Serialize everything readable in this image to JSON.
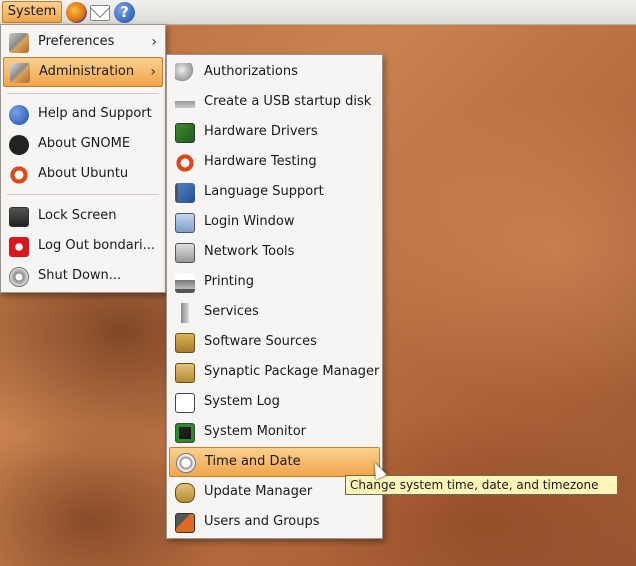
{
  "panel": {
    "menu_label": "System",
    "launchers": [
      "firefox-icon",
      "mail-icon",
      "help-icon"
    ],
    "help_glyph": "?"
  },
  "system_menu": {
    "items": [
      {
        "label": "Preferences",
        "icon": "preferences-icon",
        "submenu": true
      },
      {
        "label": "Administration",
        "icon": "administration-icon",
        "submenu": true,
        "highlighted": true
      },
      {
        "label": "Help and Support",
        "icon": "help-icon"
      },
      {
        "label": "About GNOME",
        "icon": "gnome-foot-icon"
      },
      {
        "label": "About Ubuntu",
        "icon": "ubuntu-icon"
      },
      {
        "label": "Lock Screen",
        "icon": "lock-screen-icon"
      },
      {
        "label": "Log Out bondari...",
        "icon": "log-out-icon"
      },
      {
        "label": "Shut Down...",
        "icon": "shut-down-icon"
      }
    ],
    "arrow_glyph": "›"
  },
  "admin_menu": {
    "items": [
      {
        "label": "Authorizations",
        "icon": "keys-icon"
      },
      {
        "label": "Create a USB startup disk",
        "icon": "usb-disk-icon"
      },
      {
        "label": "Hardware Drivers",
        "icon": "hardware-drivers-icon"
      },
      {
        "label": "Hardware Testing",
        "icon": "hardware-testing-icon"
      },
      {
        "label": "Language Support",
        "icon": "language-flag-icon"
      },
      {
        "label": "Login Window",
        "icon": "login-window-icon"
      },
      {
        "label": "Network Tools",
        "icon": "network-tools-icon"
      },
      {
        "label": "Printing",
        "icon": "printer-icon"
      },
      {
        "label": "Services",
        "icon": "services-icon"
      },
      {
        "label": "Software Sources",
        "icon": "software-sources-icon"
      },
      {
        "label": "Synaptic Package Manager",
        "icon": "synaptic-icon"
      },
      {
        "label": "System Log",
        "icon": "system-log-icon"
      },
      {
        "label": "System Monitor",
        "icon": "system-monitor-icon"
      },
      {
        "label": "Time and Date",
        "icon": "time-date-icon",
        "highlighted": true
      },
      {
        "label": "Update Manager",
        "icon": "update-manager-icon"
      },
      {
        "label": "Users and Groups",
        "icon": "users-groups-icon"
      }
    ]
  },
  "tooltip": {
    "text": "Change system time, date, and timezone"
  },
  "colors": {
    "highlight": "#f0a64c",
    "menu_bg": "#f6f5f3",
    "tooltip_bg": "#fbf6b7"
  }
}
